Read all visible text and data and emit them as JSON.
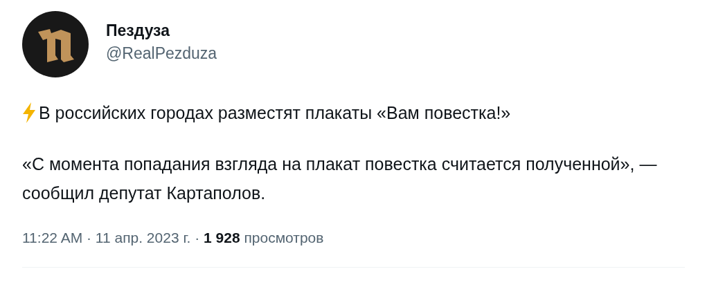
{
  "author": {
    "name": "Пездуза",
    "handle": "@RealPezduza"
  },
  "tweet": {
    "paragraphs": [
      {
        "text": "В российских городах разместят плакаты «Вам повестка!»",
        "kind": "lightning"
      },
      {
        "text": "«С момента попадания взгляда на плакат повестка считается полученной», — сообщил депутат Картаполов.",
        "kind": "plain"
      }
    ]
  },
  "meta": "11:22 AM · 11 апр. 2023 г. · **1 928** просмотров"
}
